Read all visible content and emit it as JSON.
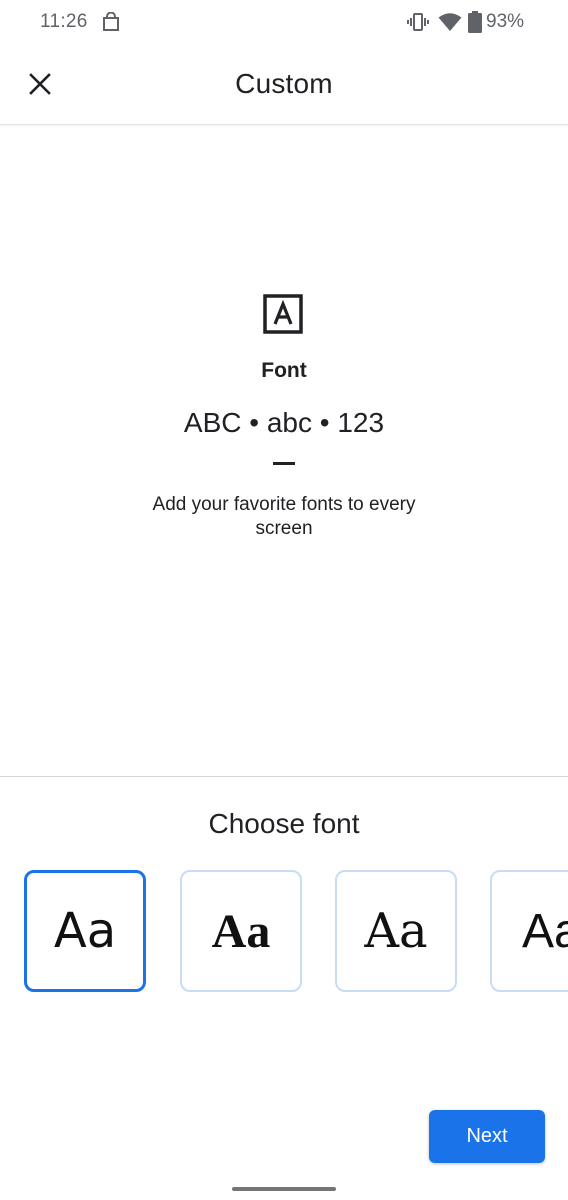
{
  "status_bar": {
    "time": "11:26",
    "battery": "93%",
    "icons": [
      "shopping-bag-icon",
      "vibrate-icon",
      "wifi-icon",
      "battery-icon"
    ]
  },
  "app_bar": {
    "title": "Custom",
    "close_icon": "close-icon"
  },
  "preview": {
    "icon": "font-letter-a-icon",
    "title": "Font",
    "sample": "ABC • abc • 123",
    "description": "Add your favorite fonts to every screen"
  },
  "chooser": {
    "title": "Choose font",
    "options": [
      {
        "label": "Aa",
        "selected": true
      },
      {
        "label": "Aa",
        "selected": false
      },
      {
        "label": "Aa",
        "selected": false
      },
      {
        "label": "Aa",
        "selected": false
      }
    ]
  },
  "actions": {
    "next_label": "Next"
  },
  "colors": {
    "accent": "#1a73e8",
    "option_border": "#c9dcf6",
    "text": "#202124",
    "status_text": "#5f6368"
  }
}
